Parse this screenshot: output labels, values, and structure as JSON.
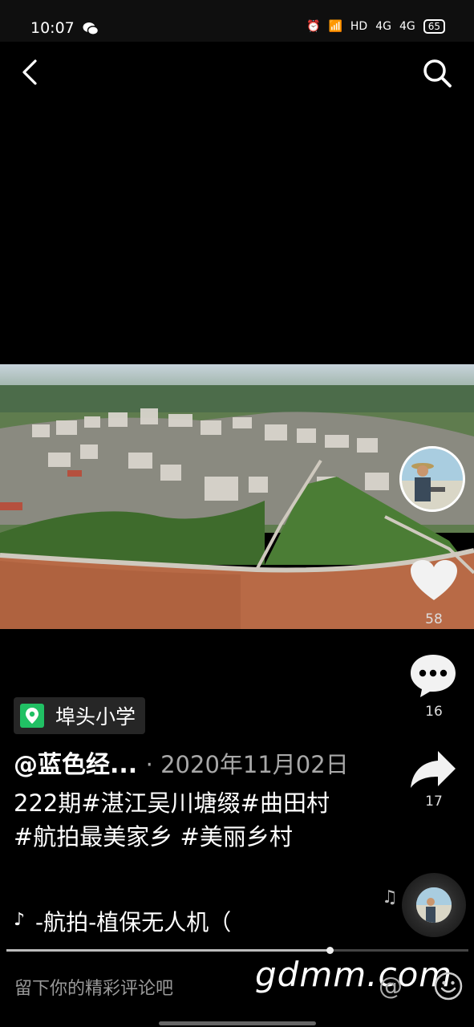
{
  "status_bar": {
    "time": "10:07",
    "network": "HD",
    "signal_1": "4G",
    "signal_2": "4G",
    "battery": "65"
  },
  "post": {
    "location": "埠头小学",
    "author": "@蓝色经...",
    "date": "· 2020年11月02日",
    "caption": "222期#湛江吴川塘缀#曲田村 #航拍最美家乡 #美丽乡村",
    "music": "-航拍-植保无人机（"
  },
  "actions": {
    "likes": "58",
    "comments": "16",
    "shares": "17"
  },
  "progress": 0.7,
  "bottom_bar": {
    "comment_placeholder": "留下你的精彩评论吧",
    "mention_symbol": "@"
  },
  "watermark": "gdmm.com",
  "icons": {
    "back": "back-arrow-icon",
    "search": "search-icon",
    "like": "heart-icon",
    "comment": "comment-bubble-icon",
    "share": "share-arrow-icon",
    "location": "location-pin-icon",
    "music": "music-note-icon",
    "emoji": "emoji-icon"
  },
  "colors": {
    "background": "#000000",
    "location_green": "#21c064",
    "muted_text": "#a8a8a8"
  }
}
